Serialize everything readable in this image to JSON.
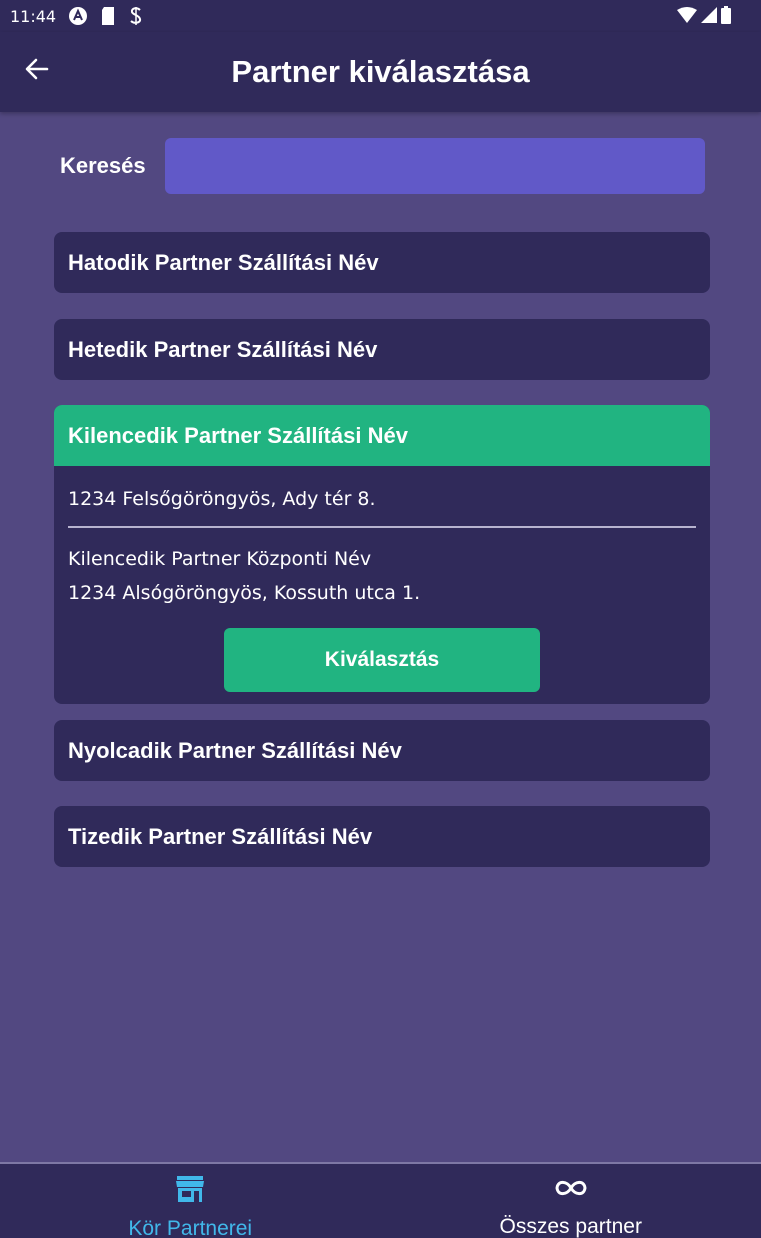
{
  "status_bar": {
    "time": "11:44"
  },
  "header": {
    "title": "Partner kiválasztása"
  },
  "search": {
    "label": "Keresés",
    "value": "",
    "placeholder": ""
  },
  "partners": [
    {
      "name": "Hatodik Partner Szállítási Név"
    },
    {
      "name": "Hetedik Partner Szállítási Név"
    },
    {
      "name": "Kilencedik Partner Szállítási Név",
      "shipping_address": "1234 Felsőgöröngyös, Ady tér 8.",
      "central_name": "Kilencedik Partner Központi Név",
      "central_address": "1234 Alsógöröngyös, Kossuth utca 1.",
      "select_label": "Kiválasztás"
    },
    {
      "name": "Nyolcadik Partner Szállítási Név"
    },
    {
      "name": "Tizedik Partner Szállítási Név"
    }
  ],
  "bottom_nav": [
    {
      "label": "Kör Partnerei",
      "icon": "store-icon",
      "active": true
    },
    {
      "label": "Összes partner",
      "icon": "infinity-icon",
      "active": false
    }
  ],
  "colors": {
    "background": "#524881",
    "bar": "#302a5a",
    "card": "#302a5a",
    "accent_green": "#21b481",
    "search_field": "#6159c8",
    "active_nav": "#41b8ea"
  }
}
